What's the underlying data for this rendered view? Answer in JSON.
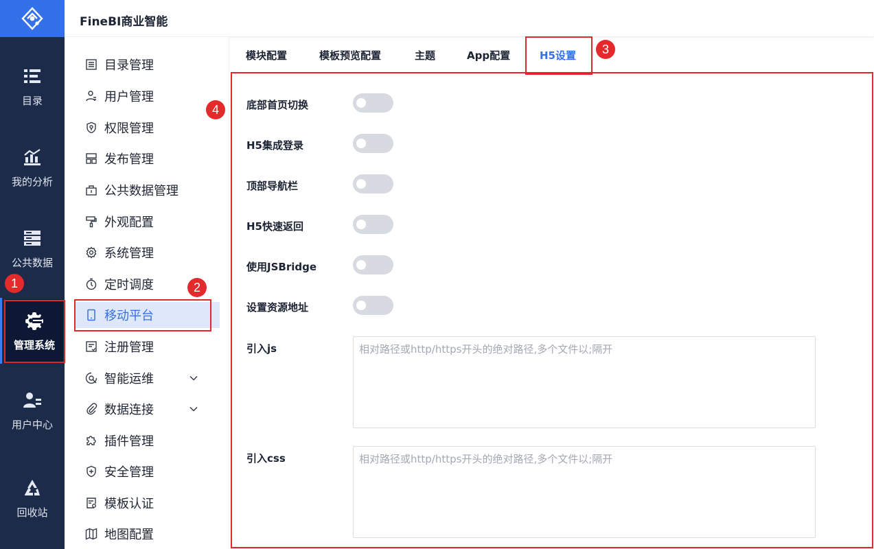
{
  "app": {
    "brand": "FineBI商业智能"
  },
  "rail": {
    "items": [
      {
        "label": "目录",
        "icon": "catalog-icon"
      },
      {
        "label": "我的分析",
        "icon": "analysis-icon"
      },
      {
        "label": "公共数据",
        "icon": "public-data-icon"
      },
      {
        "label": "管理系统",
        "icon": "gear-icon",
        "active": true
      },
      {
        "label": "用户中心",
        "icon": "user-center-icon"
      },
      {
        "label": "回收站",
        "icon": "recycle-icon"
      }
    ]
  },
  "menu": {
    "items": [
      {
        "label": "目录管理",
        "icon": "list-icon"
      },
      {
        "label": "用户管理",
        "icon": "user-icon"
      },
      {
        "label": "权限管理",
        "icon": "shield-lock-icon"
      },
      {
        "label": "发布管理",
        "icon": "publish-icon"
      },
      {
        "label": "公共数据管理",
        "icon": "briefcase-icon"
      },
      {
        "label": "外观配置",
        "icon": "paint-roller-icon"
      },
      {
        "label": "系统管理",
        "icon": "gear-icon"
      },
      {
        "label": "定时调度",
        "icon": "stopwatch-icon"
      },
      {
        "label": "移动平台",
        "icon": "mobile-icon",
        "active": true
      },
      {
        "label": "注册管理",
        "icon": "register-icon"
      },
      {
        "label": "智能运维",
        "icon": "ops-icon",
        "expandable": true
      },
      {
        "label": "数据连接",
        "icon": "paperclip-icon",
        "expandable": true
      },
      {
        "label": "插件管理",
        "icon": "puzzle-icon"
      },
      {
        "label": "安全管理",
        "icon": "shield-plus-icon"
      },
      {
        "label": "模板认证",
        "icon": "certificate-icon"
      },
      {
        "label": "地图配置",
        "icon": "map-icon"
      }
    ]
  },
  "tabs": [
    {
      "label": "模块配置"
    },
    {
      "label": "模板预览配置"
    },
    {
      "label": "主题"
    },
    {
      "label": "App配置"
    },
    {
      "label": "H5设置",
      "active": true
    }
  ],
  "settings": {
    "toggles": [
      {
        "label": "底部首页切换",
        "on": false
      },
      {
        "label": "H5集成登录",
        "on": false
      },
      {
        "label": "顶部导航栏",
        "on": false
      },
      {
        "label": "H5快速返回",
        "on": false
      },
      {
        "label": "使用JSBridge",
        "on": false
      },
      {
        "label": "设置资源地址",
        "on": false
      }
    ],
    "js": {
      "label": "引入js",
      "value": "",
      "placeholder": "相对路径或http/https开头的绝对路径,多个文件以;隔开"
    },
    "css": {
      "label": "引入css",
      "value": "",
      "placeholder": "相对路径或http/https开头的绝对路径,多个文件以;隔开"
    }
  },
  "annotations": {
    "badges": [
      "1",
      "2",
      "3",
      "4"
    ],
    "color": "#e0272c"
  },
  "colors": {
    "rail_bg": "#1d2b4b",
    "logo_bg": "#3470e8",
    "accent": "#3670e6",
    "active_menu_bg": "#dfe8fb",
    "toggle_off": "#d7dae1"
  }
}
